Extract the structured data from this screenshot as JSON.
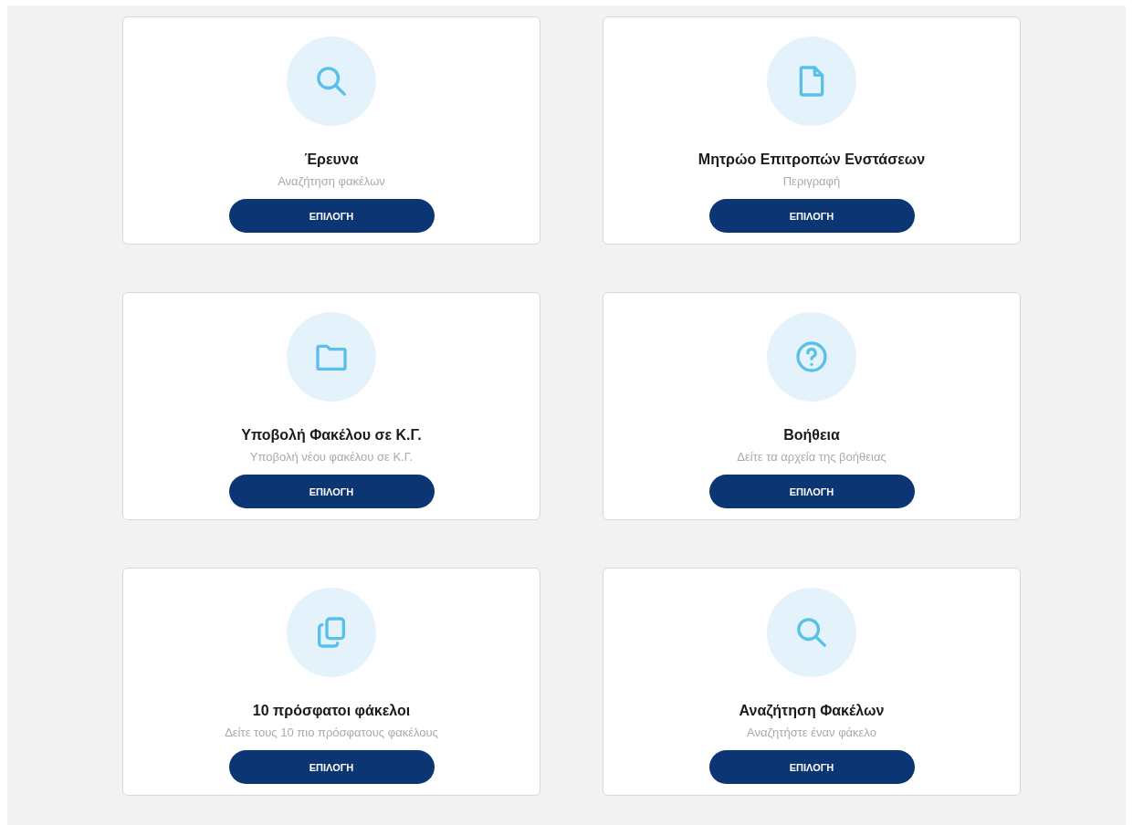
{
  "cards": [
    {
      "kind": "search",
      "title": "Έρευνα",
      "subtitle": "Αναζήτηση φακέλων",
      "button": "ΕΠΙΛΟΓΗ"
    },
    {
      "kind": "file",
      "title": "Μητρώο Επιτροπών Ενστάσεων",
      "subtitle": "Περιγραφή",
      "button": "ΕΠΙΛΟΓΗ"
    },
    {
      "kind": "folder",
      "title": "Υποβολή Φακέλου σε Κ.Γ.",
      "subtitle": "Υποβολή νέου φακέλου σε Κ.Γ.",
      "button": "ΕΠΙΛΟΓΗ"
    },
    {
      "kind": "help",
      "title": "Βοήθεια",
      "subtitle": "Δείτε τα αρχεία της βοήθειας",
      "button": "ΕΠΙΛΟΓΗ"
    },
    {
      "kind": "copy",
      "title": "10 πρόσφατοι φάκελοι",
      "subtitle": "Δείτε τους 10 πιο πρόσφατους φακέλους",
      "button": "ΕΠΙΛΟΓΗ"
    },
    {
      "kind": "search",
      "title": "Αναζήτηση Φακέλων",
      "subtitle": "Αναζητήστε έναν φάκελο",
      "button": "ΕΠΙΛΟΓΗ"
    }
  ]
}
